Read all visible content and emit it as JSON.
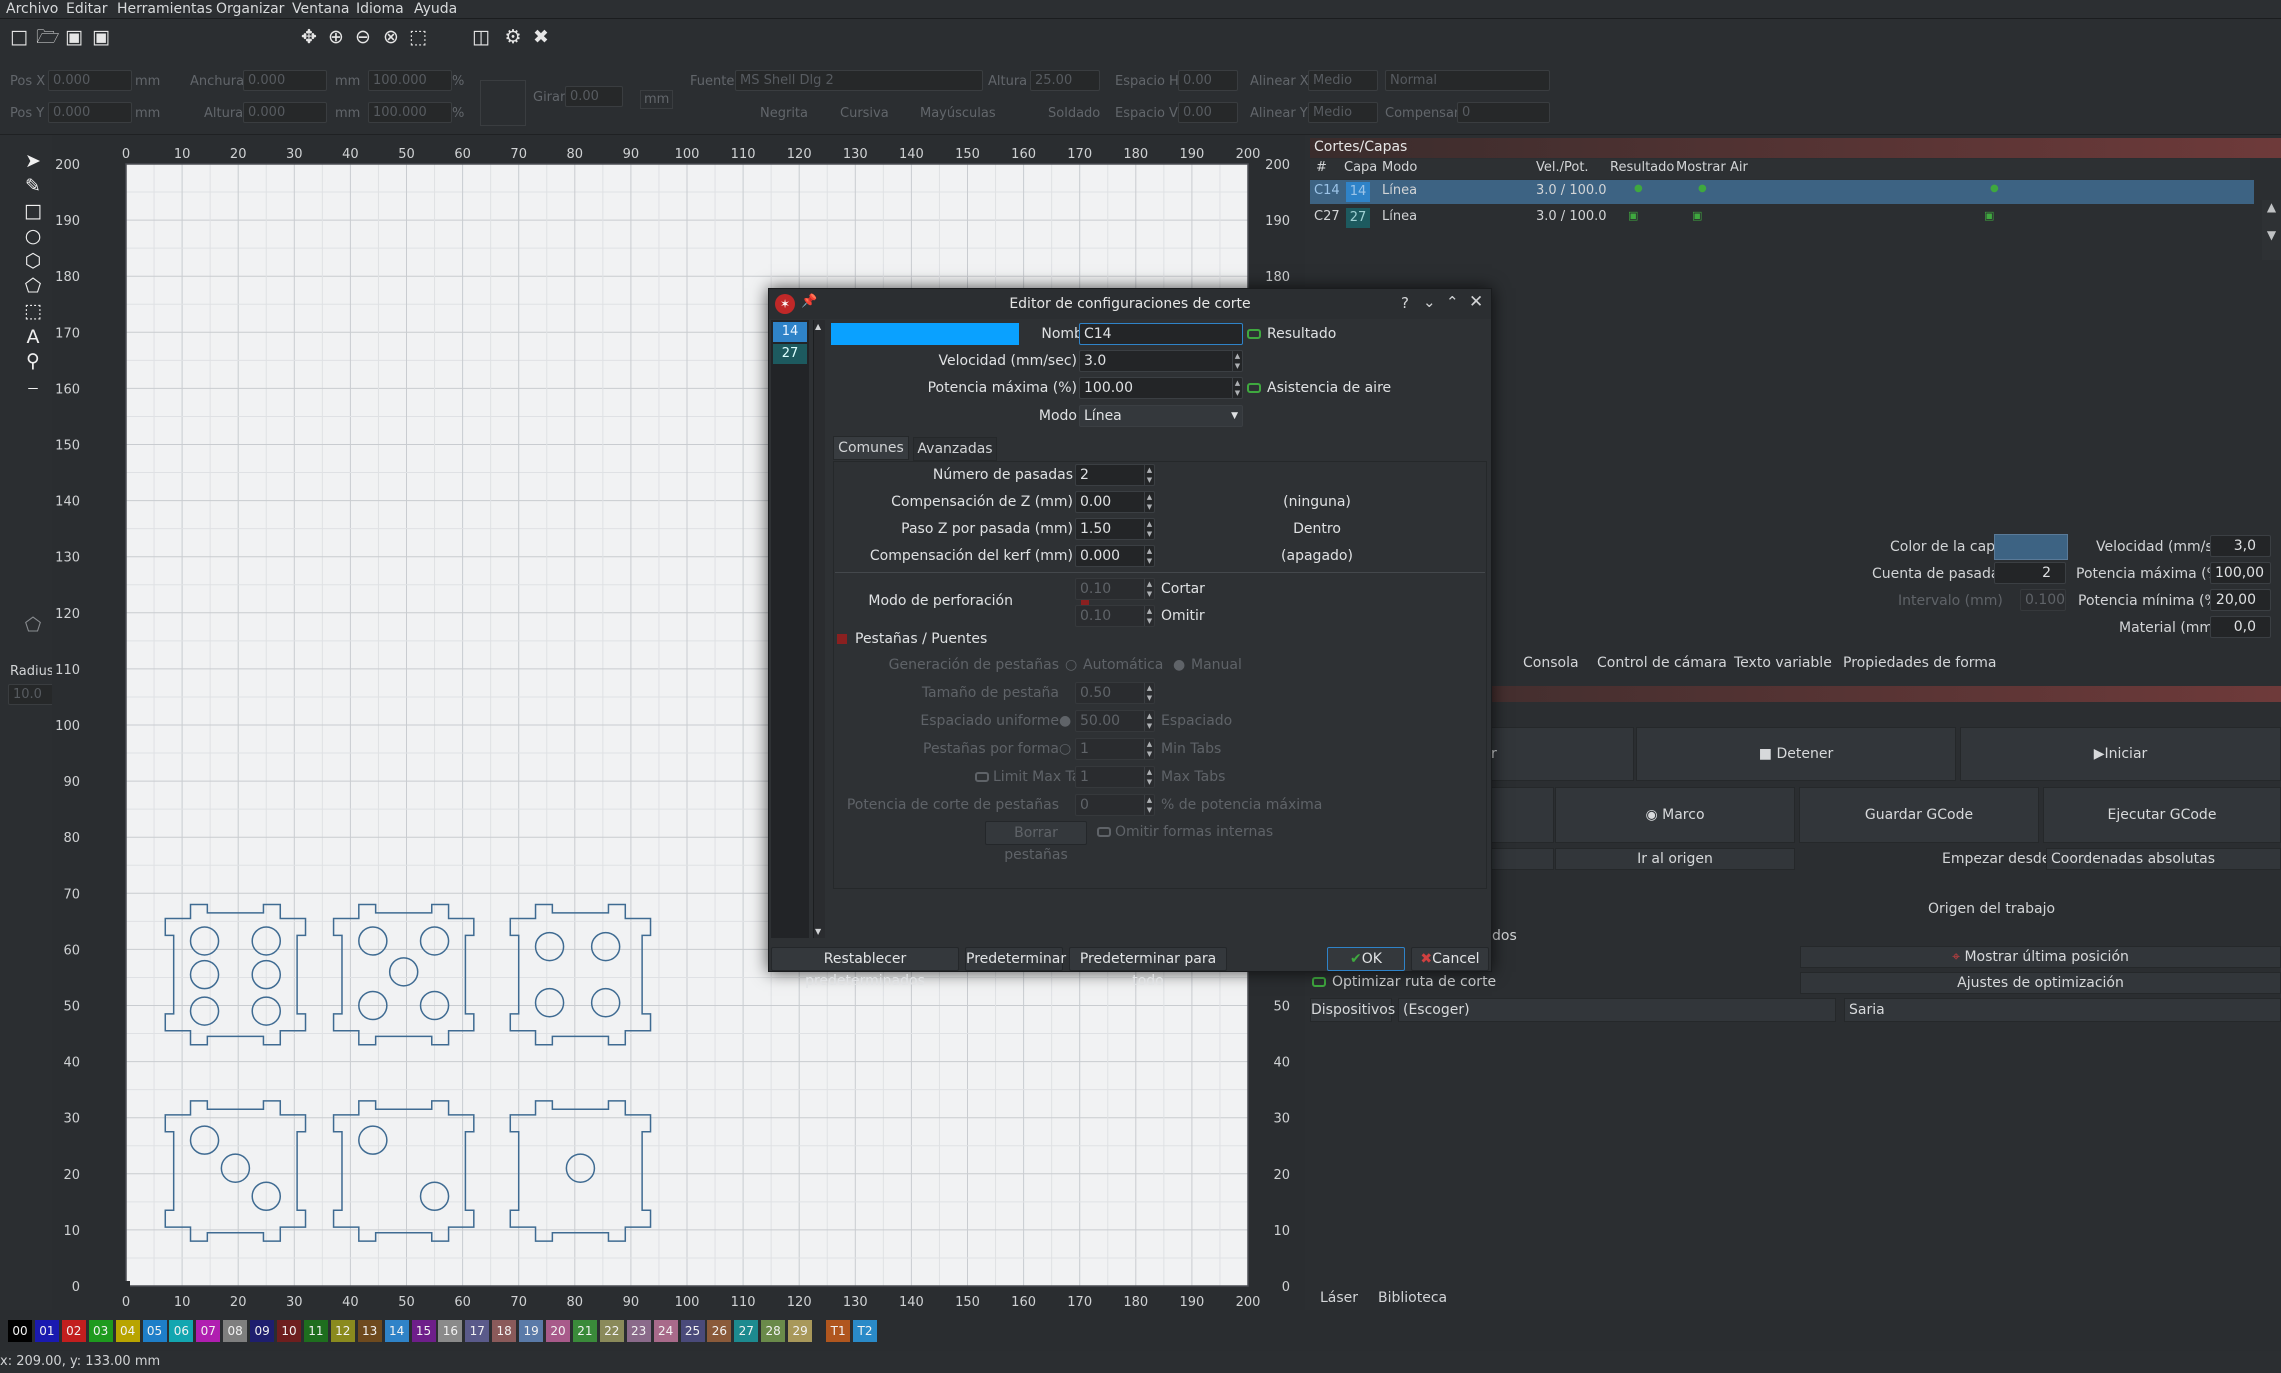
{
  "menu": [
    "Archivo",
    "Editar",
    "Herramientas",
    "Organizar",
    "Ventana",
    "Idioma",
    "Ayuda"
  ],
  "props": {
    "posx": "Pos X",
    "posy": "Pos Y",
    "posx_val": "0.000",
    "posy_val": "0.000",
    "mm": "mm",
    "anchura": "Anchura",
    "altura": "Altura",
    "w_val": "0.000",
    "h_val": "0.000",
    "pct": "100.000",
    "percent": "%",
    "girar": "Girar",
    "girar_val": "0.00",
    "fuente": "Fuente",
    "font_val": "MS Shell Dlg 2",
    "altura_font": "Altura",
    "altura_font_val": "25.00",
    "espacio_h": "Espacio H",
    "espacio_v": "Espacio V",
    "esp_val": "0.00",
    "alinear_x": "Alinear X",
    "alinear_y": "Alinear Y",
    "medio": "Medio",
    "normal": "Normal",
    "compensar": "Compensar",
    "comp_val": "0",
    "negrita": "Negrita",
    "cursiva": "Cursiva",
    "mayusculas": "Mayúsculas",
    "soldado": "Soldado"
  },
  "radius": {
    "label": "Radius:",
    "value": "10.0"
  },
  "ruler": {
    "x": [
      "0",
      "10",
      "20",
      "30",
      "40",
      "50",
      "60",
      "70",
      "80",
      "90",
      "100",
      "110",
      "120",
      "130",
      "140",
      "150",
      "160",
      "170",
      "180",
      "190",
      "200"
    ],
    "y": [
      "200",
      "190",
      "180",
      "170",
      "160",
      "150",
      "140",
      "130",
      "120",
      "110",
      "100",
      "90",
      "80",
      "70",
      "60",
      "50",
      "40",
      "30",
      "20",
      "10",
      "0"
    ]
  },
  "cuts": {
    "title": "Cortes/Capas",
    "headers": [
      "#",
      "Capa",
      "Modo",
      "Vel./Pot.",
      "Resultado",
      "Mostrar",
      "Air"
    ],
    "rows": [
      {
        "id": "C14",
        "layer": "14",
        "mode": "Línea",
        "vp": "3.0 / 100.0",
        "color": "#2f83c8"
      },
      {
        "id": "C27",
        "layer": "27",
        "mode": "Línea",
        "vp": "3.0 / 100.0",
        "color": "#1d8a8f"
      }
    ]
  },
  "layer_settings": {
    "color_capa": "Color de la capa",
    "velocidad": "Velocidad (mm/s)",
    "velocidad_val": "3,0",
    "cuenta": "Cuenta de pasadas",
    "cuenta_val": "2",
    "pot_max": "Potencia máxima (%)",
    "pot_max_val": "100,00",
    "intervalo": "Intervalo (mm)",
    "intervalo_val": "0.100",
    "pot_min": "Potencia mínima (%)",
    "pot_min_val": "20,00",
    "material": "Material (mm)",
    "material_val": "0,0"
  },
  "tabs": [
    "Consola",
    "Control de cámara",
    "Texto variable",
    "Propiedades de forma"
  ],
  "laser": {
    "r": "r",
    "detener": "Detener",
    "iniciar": "Iniciar",
    "marco": "Marco",
    "guardar": "Guardar GCode",
    "ejecutar": "Ejecutar GCode",
    "ir_origen": "Ir al origen",
    "empezar": "Empezar desde:",
    "empezar_val": "Coordenadas absolutas",
    "origen": "Origen del trabajo",
    "dos": "dos",
    "mostrar_ultima": "Mostrar última posición",
    "optimizar": "Optimizar ruta de corte",
    "ajustes": "Ajustes de optimización",
    "dispositivos": "Dispositivos",
    "escoger": "(Escoger)",
    "saria": "Saria"
  },
  "bottom_tabs": [
    "Láser",
    "Biblioteca"
  ],
  "palette": [
    {
      "n": "00",
      "c": "#000000"
    },
    {
      "n": "01",
      "c": "#1a1ab0"
    },
    {
      "n": "02",
      "c": "#c21e1e"
    },
    {
      "n": "03",
      "c": "#1e9a1e"
    },
    {
      "n": "04",
      "c": "#b8a400"
    },
    {
      "n": "05",
      "c": "#1e7ec8"
    },
    {
      "n": "06",
      "c": "#13a6b0"
    },
    {
      "n": "07",
      "c": "#b01eb0"
    },
    {
      "n": "08",
      "c": "#7f7f7f"
    },
    {
      "n": "09",
      "c": "#1e1e6e"
    },
    {
      "n": "10",
      "c": "#6e1e1e"
    },
    {
      "n": "11",
      "c": "#1e6e1e"
    },
    {
      "n": "12",
      "c": "#8a8a1e"
    },
    {
      "n": "13",
      "c": "#6e4a1e"
    },
    {
      "n": "14",
      "c": "#2f83c8"
    },
    {
      "n": "15",
      "c": "#6e1e8a"
    },
    {
      "n": "16",
      "c": "#8a8a8a"
    },
    {
      "n": "17",
      "c": "#5a5a8a"
    },
    {
      "n": "18",
      "c": "#8a5a5a"
    },
    {
      "n": "19",
      "c": "#5a7aa8"
    },
    {
      "n": "20",
      "c": "#a85a8a"
    },
    {
      "n": "21",
      "c": "#3a8a3a"
    },
    {
      "n": "22",
      "c": "#8a8a5a"
    },
    {
      "n": "23",
      "c": "#8a6a8a"
    },
    {
      "n": "24",
      "c": "#a86a8a"
    },
    {
      "n": "25",
      "c": "#4a4a7a"
    },
    {
      "n": "26",
      "c": "#8a5a3a"
    },
    {
      "n": "27",
      "c": "#1d8a8f"
    },
    {
      "n": "28",
      "c": "#6a8a4a"
    },
    {
      "n": "29",
      "c": "#a8985a"
    },
    {
      "n": "T1",
      "c": "#b0561e"
    },
    {
      "n": "T2",
      "c": "#2a8ac8"
    }
  ],
  "status": "x: 209.00, y: 133.00 mm",
  "dialog": {
    "title": "Editor de configuraciones de corte",
    "help": "?",
    "list": [
      "14",
      "27"
    ],
    "nombre": "Nombre",
    "nombre_val": "C14",
    "resultado": "Resultado",
    "velocidad": "Velocidad (mm/sec)",
    "velocidad_val": "3.0",
    "potencia": "Potencia máxima (%)",
    "potencia_val": "100.00",
    "asistencia": "Asistencia de aire",
    "modo": "Modo",
    "modo_val": "Línea",
    "tab_comunes": "Comunes",
    "tab_avanzadas": "Avanzadas",
    "pasadas": "Número de pasadas",
    "pasadas_val": "2",
    "compz": "Compensación de Z (mm)",
    "compz_val": "0.00",
    "ninguna": "(ninguna)",
    "pasoz": "Paso Z por pasada (mm)",
    "pasoz_val": "1.50",
    "dentro": "Dentro",
    "kerf": "Compensación del kerf (mm)",
    "kerf_val": "0.000",
    "apagado": "(apagado)",
    "perf": "Modo de perforación",
    "perf_val": "0.10",
    "cortar": "Cortar",
    "omitir": "Omitir",
    "pestanas": "Pestañas / Puentes",
    "gen": "Generación de pestañas",
    "auto": "Automática",
    "manual": "Manual",
    "tamano": "Tamaño de pestaña",
    "tamano_val": "0.50",
    "espaciado": "Espaciado uniforme",
    "espaciado_val": "50.00",
    "espaciado_lbl": "Espaciado",
    "por_forma": "Pestañas por forma",
    "por_forma_val": "1",
    "min_tabs": "Min Tabs",
    "limit": "Limit Max Tabs",
    "limit_val": "1",
    "max_tabs": "Max Tabs",
    "pot_corte": "Potencia de corte de pestañas",
    "pot_corte_val": "0",
    "pct_max": "% de potencia máxima",
    "borrar": "Borrar pestañas",
    "omitir_int": "Omitir formas internas",
    "restablecer": "Restablecer predeterminados",
    "predeterminar": "Predeterminar",
    "predet_todo": "Predeterminar para todo",
    "ok": "OK",
    "cancel": "Cancel"
  }
}
